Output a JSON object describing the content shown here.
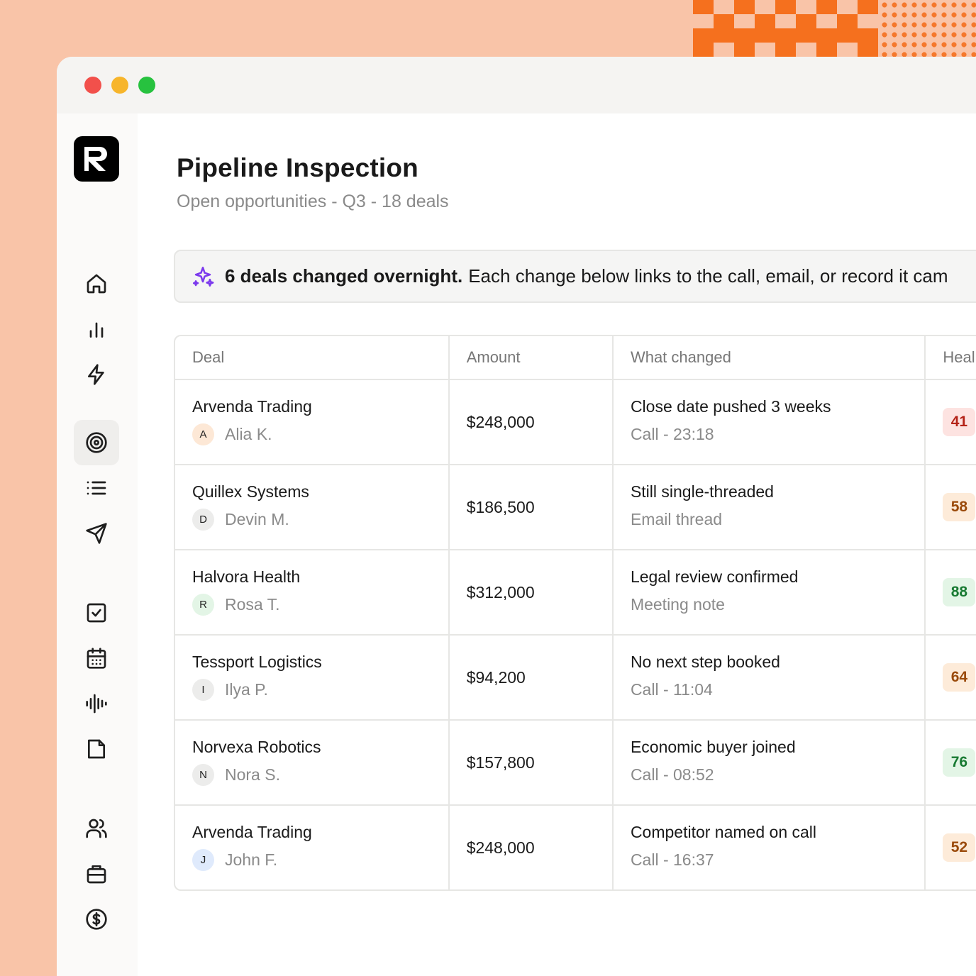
{
  "window": {
    "traffic_lights": [
      {
        "name": "close",
        "color": "#f2504b"
      },
      {
        "name": "minimize",
        "color": "#f7b52b"
      },
      {
        "name": "zoom",
        "color": "#27c23f"
      }
    ]
  },
  "sidebar": {
    "logo": "app-logo",
    "items": [
      {
        "id": "home",
        "icon": "home-icon"
      },
      {
        "id": "analytics",
        "icon": "bar-chart-icon"
      },
      {
        "id": "activity",
        "icon": "lightning-icon"
      },
      {
        "id": "pipeline",
        "icon": "target-icon",
        "active": true
      },
      {
        "id": "lists",
        "icon": "list-icon"
      },
      {
        "id": "outreach",
        "icon": "send-icon"
      },
      {
        "id": "tasks",
        "icon": "checkbox-icon"
      },
      {
        "id": "calendar",
        "icon": "calendar-icon"
      },
      {
        "id": "recordings",
        "icon": "audio-wave-icon"
      },
      {
        "id": "documents",
        "icon": "file-icon"
      },
      {
        "id": "contacts",
        "icon": "users-icon"
      },
      {
        "id": "accounts",
        "icon": "briefcase-icon"
      },
      {
        "id": "revenue",
        "icon": "dollar-icon"
      },
      {
        "id": "integrations",
        "icon": "package-icon"
      }
    ]
  },
  "page": {
    "title": "Pipeline Inspection",
    "subtitle": "Open opportunities - Q3 - 18 deals"
  },
  "banner": {
    "icon": "sparkle-icon",
    "strong": "6 deals changed overnight.",
    "text": "Each change below links to the call, email, or record it cam"
  },
  "table": {
    "columns": [
      "Deal",
      "Amount",
      "What changed",
      "Heal"
    ],
    "rows": [
      {
        "deal": "Arvenda Trading",
        "owner_initial": "A",
        "owner": "Alia K.",
        "owner_color": "#fde8d6",
        "amount": "$248,000",
        "change": "Close date pushed 3 weeks",
        "source": "Call - 23:18",
        "health": "41",
        "health_bg": "#fde3e1",
        "health_fg": "#b42318"
      },
      {
        "deal": "Quillex Systems",
        "owner_initial": "D",
        "owner": "Devin M.",
        "owner_color": "#ececeb",
        "amount": "$186,500",
        "change": "Still single-threaded",
        "source": "Email thread",
        "health": "58",
        "health_bg": "#fdebd9",
        "health_fg": "#9a4a0a"
      },
      {
        "deal": "Halvora Health",
        "owner_initial": "R",
        "owner": "Rosa T.",
        "owner_color": "#e3f5e6",
        "amount": "$312,000",
        "change": "Legal review confirmed",
        "source": "Meeting note",
        "health": "88",
        "health_bg": "#e3f5e6",
        "health_fg": "#187a32"
      },
      {
        "deal": "Tessport Logistics",
        "owner_initial": "I",
        "owner": "Ilya P.",
        "owner_color": "#ececeb",
        "amount": "$94,200",
        "change": "No next step booked",
        "source": "Call - 11:04",
        "health": "64",
        "health_bg": "#fdebd9",
        "health_fg": "#9a4a0a"
      },
      {
        "deal": "Norvexa Robotics",
        "owner_initial": "N",
        "owner": "Nora S.",
        "owner_color": "#ececeb",
        "amount": "$157,800",
        "change": "Economic buyer joined",
        "source": "Call - 08:52",
        "health": "76",
        "health_bg": "#e3f5e6",
        "health_fg": "#187a32"
      },
      {
        "deal": "Arvenda Trading",
        "owner_initial": "J",
        "owner": "John F.",
        "owner_color": "#dfeafc",
        "amount": "$248,000",
        "change": "Competitor named on call",
        "source": "Call - 16:37",
        "health": "52",
        "health_bg": "#fdebd9",
        "health_fg": "#9a4a0a"
      }
    ]
  }
}
